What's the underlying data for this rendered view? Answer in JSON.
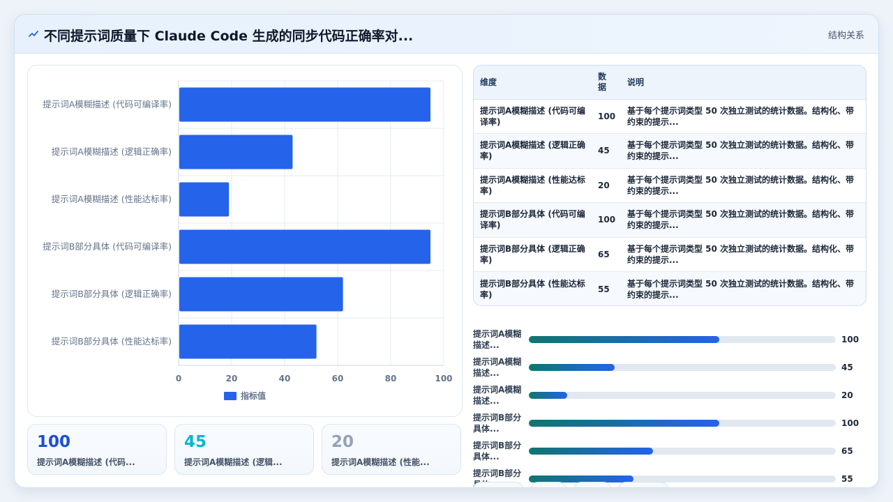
{
  "header": {
    "title": "不同提示词质量下 Claude Code 生成的同步代码正确率对...",
    "link": "结构关系"
  },
  "chart_data": {
    "type": "bar",
    "orientation": "horizontal",
    "categories": [
      "提示词A模糊描述 (代码可编译率)",
      "提示词A模糊描述 (逻辑正确率)",
      "提示词A模糊描述 (性能达标率)",
      "提示词B部分具体 (代码可编译率)",
      "提示词B部分具体 (逻辑正确率)",
      "提示词B部分具体 (性能达标率)"
    ],
    "series": [
      {
        "name": "指标值",
        "values": [
          95,
          43,
          19,
          95,
          62,
          52
        ],
        "color": "#2563eb"
      }
    ],
    "xlim": [
      0,
      100
    ],
    "xticks": [
      "0",
      "20",
      "40",
      "60",
      "80",
      "100"
    ],
    "grid": true,
    "legend": "bottom"
  },
  "stats": [
    {
      "value": "100",
      "label": "提示词A模糊描述 (代码...",
      "color": "#1d4ed8"
    },
    {
      "value": "45",
      "label": "提示词A模糊描述 (逻辑...",
      "color": "#06b6d4"
    },
    {
      "value": "20",
      "label": "提示词A模糊描述 (性能...",
      "color": "#94a3b8"
    }
  ],
  "table": {
    "headers": [
      "维度",
      "数据",
      "说明"
    ],
    "rows": [
      {
        "dim": "提示词A模糊描述 (代码可编译率)",
        "val": "100",
        "desc": "基于每个提示词类型 50 次独立测试的统计数据。结构化、带约束的提示..."
      },
      {
        "dim": "提示词A模糊描述 (逻辑正确率)",
        "val": "45",
        "desc": "基于每个提示词类型 50 次独立测试的统计数据。结构化、带约束的提示..."
      },
      {
        "dim": "提示词A模糊描述 (性能达标率)",
        "val": "20",
        "desc": "基于每个提示词类型 50 次独立测试的统计数据。结构化、带约束的提示..."
      },
      {
        "dim": "提示词B部分具体 (代码可编译率)",
        "val": "100",
        "desc": "基于每个提示词类型 50 次独立测试的统计数据。结构化、带约束的提示..."
      },
      {
        "dim": "提示词B部分具体 (逻辑正确率)",
        "val": "65",
        "desc": "基于每个提示词类型 50 次独立测试的统计数据。结构化、带约束的提示..."
      },
      {
        "dim": "提示词B部分具体 (性能达标率)",
        "val": "55",
        "desc": "基于每个提示词类型 50 次独立测试的统计数据。结构化、带约束的提示..."
      }
    ]
  },
  "progress": [
    {
      "label": "提示词A模糊描述...",
      "value": "100",
      "fraction": 0.62
    },
    {
      "label": "提示词A模糊描述...",
      "value": "45",
      "fraction": 0.28
    },
    {
      "label": "提示词A模糊描述...",
      "value": "20",
      "fraction": 0.125
    },
    {
      "label": "提示词B部分具体...",
      "value": "100",
      "fraction": 0.62
    },
    {
      "label": "提示词B部分具体...",
      "value": "65",
      "fraction": 0.405
    },
    {
      "label": "提示词B部分具体...",
      "value": "55",
      "fraction": 0.34
    }
  ],
  "header_icon": "sparkline-icon"
}
